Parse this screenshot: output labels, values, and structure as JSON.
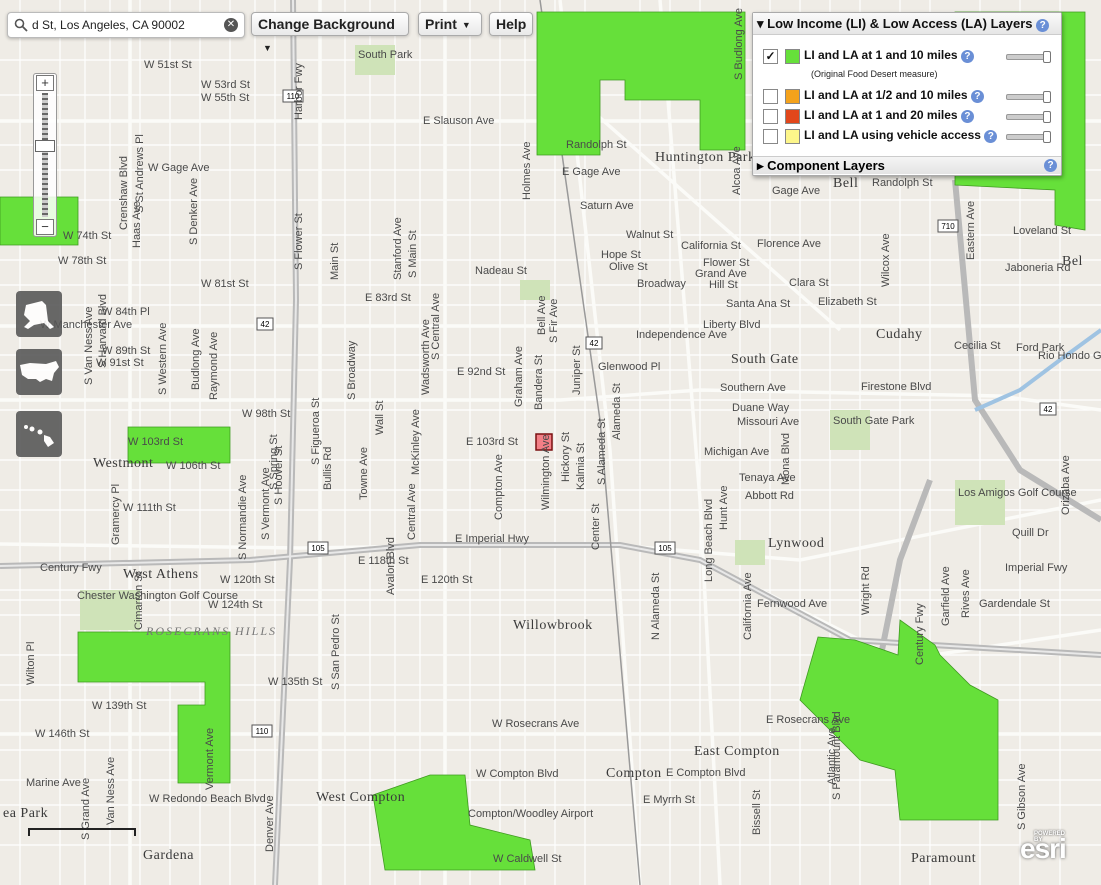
{
  "toolbar": {
    "search_value": "d St, Los Angeles, CA 90002",
    "change_background": "Change Background",
    "print": "Print",
    "help": "Help"
  },
  "zoom": {
    "in": "+",
    "out": "−"
  },
  "layers_panel": {
    "title": "Low Income (LI) & Low Access (LA) Layers",
    "help": "?",
    "layers": [
      {
        "label": "LI and LA at 1 and 10 miles",
        "checked": true,
        "color": "#66e03a",
        "note": "(Original Food Desert measure)"
      },
      {
        "label": "LI and LA at 1/2 and 10 miles",
        "checked": false,
        "color": "#f4a21c"
      },
      {
        "label": "LI and LA at 1 and 20 miles",
        "checked": false,
        "color": "#e2471b"
      },
      {
        "label": "LI and LA using vehicle access",
        "checked": false,
        "color": "#fdf68a"
      }
    ],
    "component_layers": "Component Layers"
  },
  "logo": {
    "text": "esri",
    "powered": "POWERED BY"
  },
  "map": {
    "tract_color": "#66e03a",
    "place_labels": [
      "Huntington Park",
      "Bell",
      "Cudahy",
      "South Gate",
      "Westmont",
      "West Athens",
      "Lynwood",
      "Willowbrook",
      "East Compton",
      "Compton",
      "West Compton",
      "Gardena",
      "Paramount",
      "ROSECRANS HILLS",
      "ea Park",
      "Bel"
    ],
    "street_labels": [
      "E Slauson Ave",
      "W Gage Ave",
      "W 51st St",
      "W 53rd St",
      "W 55th St",
      "W 74th St",
      "W 78th St",
      "W 81st St",
      "E 83rd St",
      "W 84th Pl",
      "W Manchester Ave",
      "W 89th St",
      "W 91st St",
      "E 92nd St",
      "W 98th St",
      "E 103rd St",
      "W 103rd St",
      "W 106th St",
      "W 111th St",
      "E Imperial Hwy",
      "Century Fwy",
      "E 118th St",
      "W 120th St",
      "E 120th St",
      "W 124th St",
      "W 135th St",
      "W 139th St",
      "W 146th St",
      "W Rosecrans Ave",
      "E Rosecrans Ave",
      "W Compton Blvd",
      "E Compton Blvd",
      "W Redondo Beach Blvd",
      "E Myrrh St",
      "W Caldwell St",
      "Marine Ave",
      "Randolph St",
      "E Gage Ave",
      "Saturn Ave",
      "Walnut St",
      "California St",
      "Florence Ave",
      "Gage Ave",
      "Randolph St",
      "Nadeau St",
      "Hope St",
      "Olive St",
      "Flower St",
      "Grand Ave",
      "Hill St",
      "Broadway",
      "Clara St",
      "Elizabeth St",
      "Santa Ana St",
      "Liberty Blvd",
      "Independence Ave",
      "Glenwood Pl",
      "Southern Ave",
      "Duane Way",
      "Missouri Ave",
      "Firestone Blvd",
      "Michigan Ave",
      "Tenaya Ave",
      "Abbott Rd",
      "Fernwood Ave",
      "Gardendale St",
      "Imperial Fwy",
      "Quill Dr",
      "Loveland St",
      "Jaboneria Rd",
      "Cecilia St",
      "Rio Hondo Golf Club",
      "Los Amigos Golf Course",
      "South Gate Park",
      "South Park",
      "Chester Washington Golf Course",
      "Compton/Woodley Airport",
      "Ford Park",
      "Century Fwy",
      "Wilcox Ave",
      "Eastern Ave",
      "Wright Rd",
      "Garfield Ave",
      "Atlantic Ave",
      "Alameda St",
      "S Alameda St",
      "N Alameda St",
      "Long Beach Blvd",
      "Wilmington Ave",
      "Hickory St",
      "Kalmia St",
      "Compton Ave",
      "Graham Ave",
      "Bandera St",
      "Juniper St",
      "Bell Ave",
      "S Fir Ave",
      "Holmes Ave",
      "Central Ave",
      "S Central Ave",
      "Wadsworth Ave",
      "McKinley Ave",
      "Avalon Blvd",
      "Stanford Ave",
      "S Main St",
      "Main St",
      "S San Pedro St",
      "Towne Ave",
      "Wall St",
      "S Broadway",
      "S Figueroa St",
      "S Hoover St",
      "S Vermont Ave",
      "S Normandie Ave",
      "Budlong Ave",
      "Raymond Ave",
      "S Denker Ave",
      "S Western Ave",
      "Haas Ave",
      "S Van Ness Ave",
      "S Harvard Blvd",
      "S St Andrews Pl",
      "Crenshaw Blvd",
      "Wilton Pl",
      "Gramercy Pl",
      "Van Ness Ave",
      "S Grand Ave",
      "S Flower St",
      "Harbor Fwy",
      "Denver Ave",
      "S Spring St",
      "Bullis Rd",
      "California Ave",
      "Hunt Ave",
      "Mona Blvd",
      "Center St",
      "Rives Ave",
      "Orizaba Ave",
      "S Gibson Ave",
      "S Paramount Blvd",
      "Bissell St",
      "Alcoa Ave",
      "S Budlong Ave",
      "Vermont Ave",
      "Cimarron St"
    ],
    "highway_shields": [
      "110",
      "42",
      "105",
      "710",
      "42",
      "110",
      "105"
    ]
  }
}
